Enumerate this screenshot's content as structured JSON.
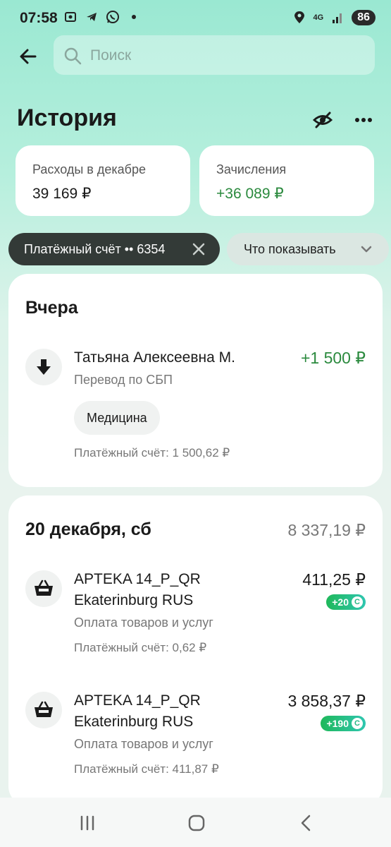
{
  "status_bar": {
    "time": "07:58",
    "network": "4G",
    "battery": "86",
    "icons": [
      "screenshot-icon",
      "telegram-icon",
      "whatsapp-icon",
      "dot-icon",
      "location-icon",
      "signal-icon"
    ]
  },
  "search": {
    "placeholder": "Поиск"
  },
  "header": {
    "title": "История"
  },
  "summary": {
    "expenses_label": "Расходы в декабре",
    "expenses_value": "39 169 ₽",
    "income_label": "Зачисления",
    "income_value": "+36 089 ₽"
  },
  "filters": {
    "account_chip": "Платёжный счёт •• 6354",
    "show_chip": "Что показывать"
  },
  "groups": [
    {
      "title": "Вчера",
      "transactions": [
        {
          "name": "Татьяна Алексеевна М.",
          "type": "Перевод по СБП",
          "amount": "+1 500 ₽",
          "category": "Медицина",
          "balance": "Платёжный счёт: 1 500,62 ₽",
          "icon": "arrow-down-icon"
        }
      ]
    },
    {
      "title": "20 декабря, сб",
      "total": "8 337,19 ₽",
      "transactions": [
        {
          "name_line1": "APTEKA 14_P_QR",
          "name_line2": "Ekaterinburg RUS",
          "type": "Оплата товаров и услуг",
          "amount": "411,25 ₽",
          "bonus": "+20",
          "balance": "Платёжный счёт: 0,62 ₽",
          "icon": "basket-icon"
        },
        {
          "name_line1": "APTEKA 14_P_QR",
          "name_line2": "Ekaterinburg RUS",
          "type": "Оплата товаров и услуг",
          "amount": "3 858,37 ₽",
          "bonus": "+190",
          "balance": "Платёжный счёт: 411,87 ₽",
          "icon": "basket-icon"
        }
      ]
    }
  ],
  "colors": {
    "accent_green": "#2b8a3e",
    "header_gradient": "#9ae8d2",
    "chip_dark": "#333a37"
  }
}
